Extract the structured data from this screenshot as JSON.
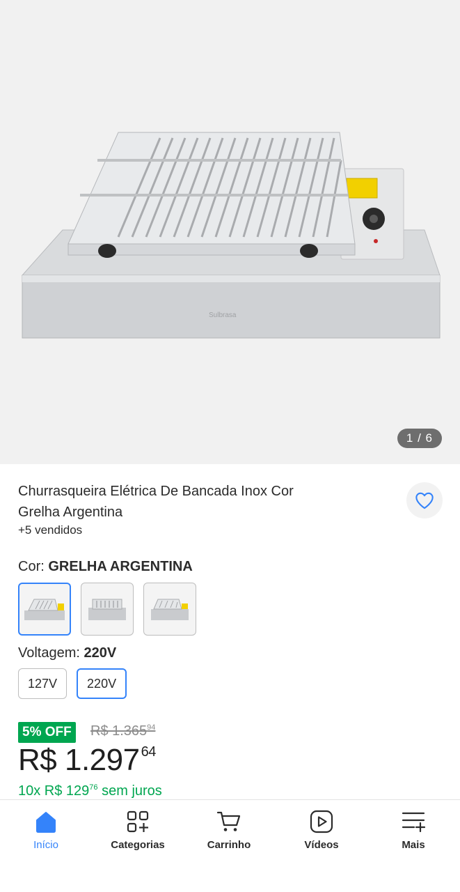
{
  "gallery": {
    "counter": "1 / 6",
    "image": "stainless-electric-grill-photo"
  },
  "product": {
    "title": "Churrasqueira Elétrica De Bancada Inox Cor Grelha Argentina",
    "sold": "+5 vendidos",
    "favorite_icon": "heart-icon"
  },
  "color": {
    "label": "Cor:",
    "selected": "GRELHA ARGENTINA",
    "swatches": [
      "grill-variant-1",
      "grill-variant-2",
      "grill-variant-3"
    ],
    "selected_index": 0
  },
  "voltage": {
    "label": "Voltagem:",
    "selected": "220V",
    "options": [
      "127V",
      "220V"
    ]
  },
  "pricing": {
    "discount": "5% OFF",
    "old_price_main": "R$ 1.365",
    "old_price_cents": "94",
    "price_main": "R$ 1.297",
    "price_cents": "64",
    "installment_prefix": "10x R$ 129",
    "installment_cents": "76",
    "installment_suffix": " sem juros"
  },
  "tabbar": {
    "items": [
      {
        "label": "Início",
        "icon": "home-icon",
        "active": true
      },
      {
        "label": "Categorias",
        "icon": "categories-icon",
        "active": false
      },
      {
        "label": "Carrinho",
        "icon": "cart-icon",
        "active": false
      },
      {
        "label": "Vídeos",
        "icon": "video-play-icon",
        "active": false
      },
      {
        "label": "Mais",
        "icon": "more-menu-icon",
        "active": false
      }
    ]
  },
  "colors": {
    "accent": "#3483fa",
    "discount": "#00a650",
    "background": "#f1f1f1"
  }
}
